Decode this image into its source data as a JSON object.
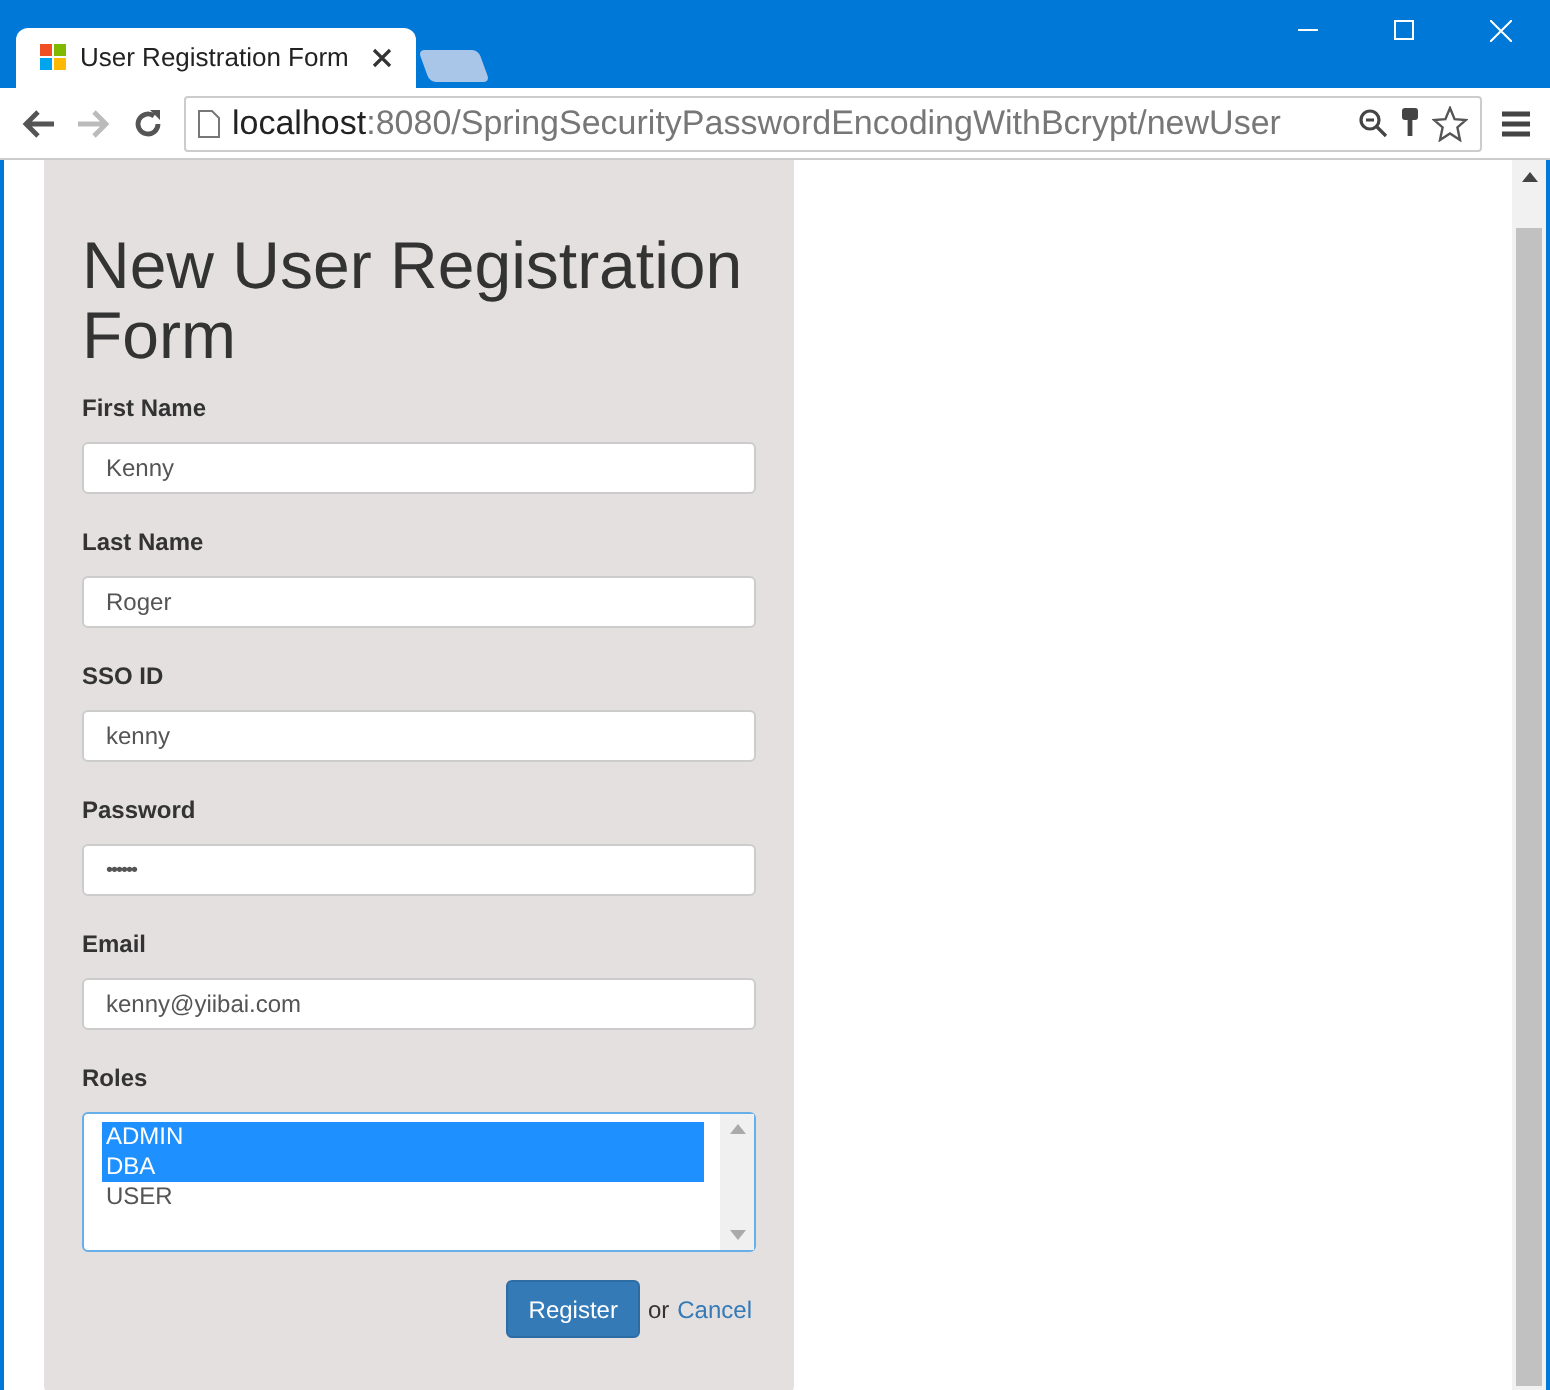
{
  "browser": {
    "tab_title": "User Registration Form",
    "url_host": "localhost",
    "url_path": ":8080/SpringSecurityPasswordEncodingWithBcrypt/newUser"
  },
  "form": {
    "title": "New User Registration Form",
    "fields": [
      {
        "label": "First Name",
        "value": "Kenny",
        "kind": "text"
      },
      {
        "label": "Last Name",
        "value": "Roger",
        "kind": "text"
      },
      {
        "label": "SSO ID",
        "value": "kenny",
        "kind": "text"
      },
      {
        "label": "Password",
        "value": "••••••",
        "kind": "password"
      },
      {
        "label": "Email",
        "value": "kenny@yiibai.com",
        "kind": "text"
      }
    ],
    "roles": {
      "label": "Roles",
      "options": [
        {
          "label": "ADMIN",
          "selected": true
        },
        {
          "label": "DBA",
          "selected": true
        },
        {
          "label": "USER",
          "selected": false
        }
      ]
    },
    "submit": "Register",
    "or": "or",
    "cancel": "Cancel"
  }
}
